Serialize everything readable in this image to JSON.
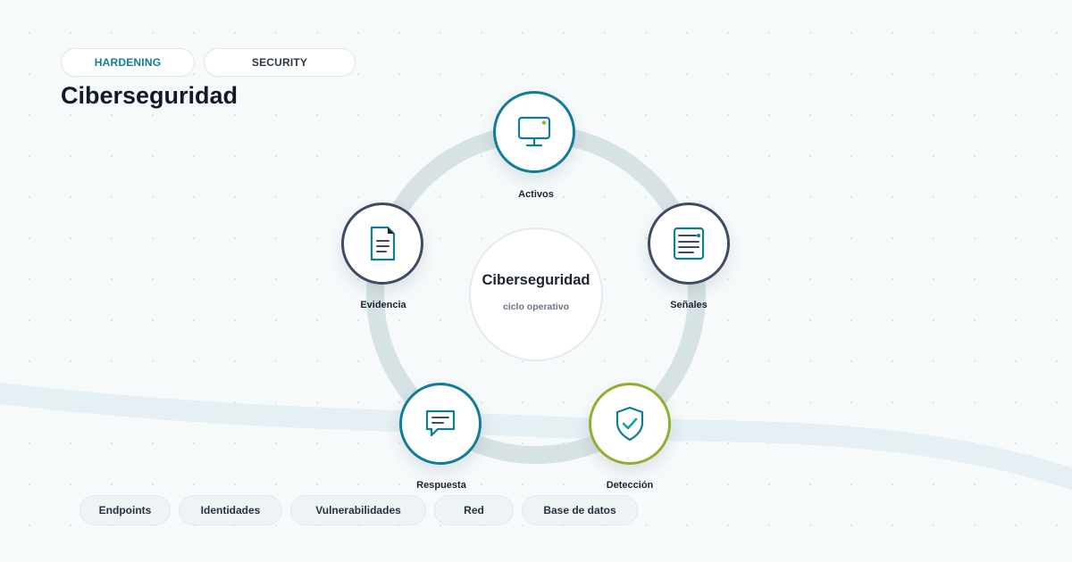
{
  "tags": [
    "HARDENING",
    "SECURITY"
  ],
  "title": "Ciberseguridad",
  "center": {
    "title": "Ciberseguridad",
    "subtitle": "ciclo operativo"
  },
  "nodes": [
    {
      "label": "Activos",
      "icon": "monitor-icon"
    },
    {
      "label": "Señales",
      "icon": "log-list-icon"
    },
    {
      "label": "Detección",
      "icon": "shield-check-icon"
    },
    {
      "label": "Respuesta",
      "icon": "chat-bubble-icon"
    },
    {
      "label": "Evidencia",
      "icon": "document-icon"
    }
  ],
  "chips": [
    "Endpoints",
    "Identidades",
    "Vulnerabilidades",
    "Red",
    "Base de datos"
  ],
  "colors": {
    "primary": "#0f7c98",
    "slate": "#3d4c63",
    "accent_green": "#8fb02f",
    "teal_icon": "#12a3a3",
    "ring": "#d7e2e4"
  }
}
